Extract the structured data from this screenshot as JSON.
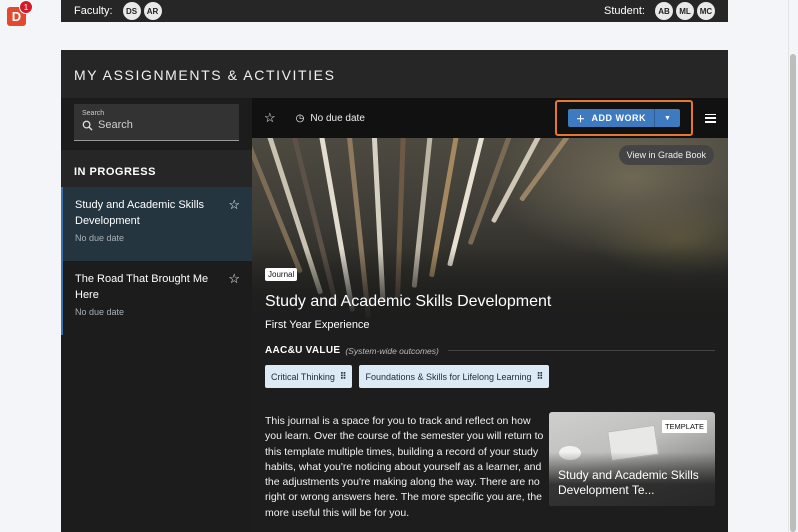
{
  "app": {
    "logo_letter": "D",
    "notification_count": "1"
  },
  "topbar": {
    "faculty_label": "Faculty:",
    "faculty": [
      "DS",
      "AR"
    ],
    "student_label": "Student:",
    "students": [
      "AB",
      "ML",
      "MC"
    ]
  },
  "panel": {
    "title": "MY ASSIGNMENTS & ACTIVITIES"
  },
  "sidebar": {
    "search": {
      "label": "Search",
      "placeholder": "Search"
    },
    "section": "IN PROGRESS",
    "items": [
      {
        "title": "Study and Academic Skills Development",
        "due": "No due date",
        "active": true
      },
      {
        "title": "The Road That Brought Me Here",
        "due": "No due date",
        "active": false
      }
    ]
  },
  "toolbar": {
    "due": "No due date",
    "add_work": "ADD WORK"
  },
  "hero": {
    "gradebook": "View in Grade Book"
  },
  "assignment": {
    "tag": "Journal",
    "title": "Study and Academic Skills Development",
    "course": "First Year Experience",
    "aac_label": "AAC&U VALUE",
    "aac_note": "(System-wide outcomes)",
    "outcomes": [
      "Critical Thinking",
      "Foundations & Skills for Lifelong Learning"
    ],
    "description": "This journal is a space for you to track and reflect on how you learn. Over the course of the semester you will return to this template multiple times, building a record of your study habits, what you're noticing about yourself as a learner, and the adjustments you're making along the way. There are no right or wrong answers here. The more specific you are, the more useful this will be for you."
  },
  "template_card": {
    "tag": "TEMPLATE",
    "title": "Study and Academic Skills Development Te..."
  },
  "colors": {
    "accent": "#3d7abf",
    "highlight": "#e8772e",
    "logo": "#e14a2f"
  }
}
